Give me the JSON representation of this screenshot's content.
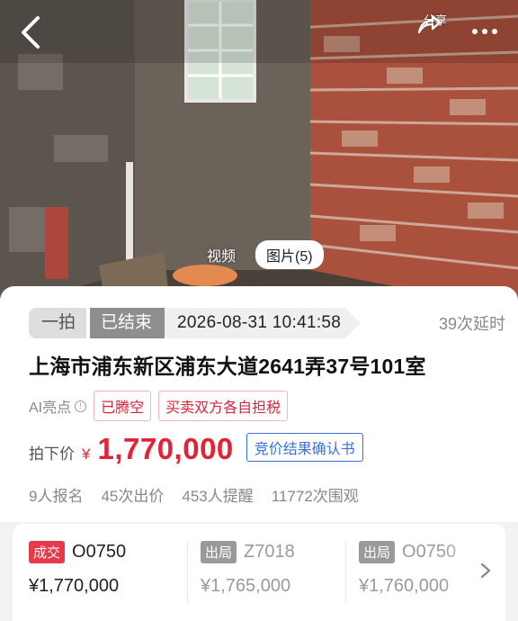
{
  "header": {
    "share_label": "分享"
  },
  "media": {
    "tabs": [
      {
        "label": "视频"
      },
      {
        "label": "图片(5)"
      }
    ]
  },
  "auction": {
    "round": "一拍",
    "status": "已结束",
    "end_time": "2026-08-31 10:41:58",
    "delay_count": "39次延时",
    "address": "上海市浦东新区浦东大道2641弄37号101室",
    "ai_label": "AI亮点",
    "highlights": [
      "已腾空",
      "买卖双方各自担税"
    ],
    "price_label": "拍下价",
    "currency": "¥",
    "price": "1,770,000",
    "confirm_label": "竞价结果确认书",
    "stats": [
      "9人报名",
      "45次出价",
      "453人提醒",
      "11772次围观"
    ]
  },
  "bids": [
    {
      "tag": "成交",
      "code": "O0750",
      "amount": "¥1,770,000",
      "state": "deal"
    },
    {
      "tag": "出局",
      "code": "Z7018",
      "amount": "¥1,765,000",
      "state": "out"
    },
    {
      "tag": "出局",
      "code": "O0750",
      "amount": "¥1,760,000",
      "state": "out"
    }
  ],
  "colors": {
    "accent_red": "#e02435",
    "link_blue": "#3b6fd9",
    "brick": "#b5533e",
    "muted": "#888888"
  },
  "icons": [
    "back-chevron-icon",
    "share-arrow-icon",
    "more-dots-icon",
    "info-circle-icon",
    "chevron-right-icon"
  ]
}
